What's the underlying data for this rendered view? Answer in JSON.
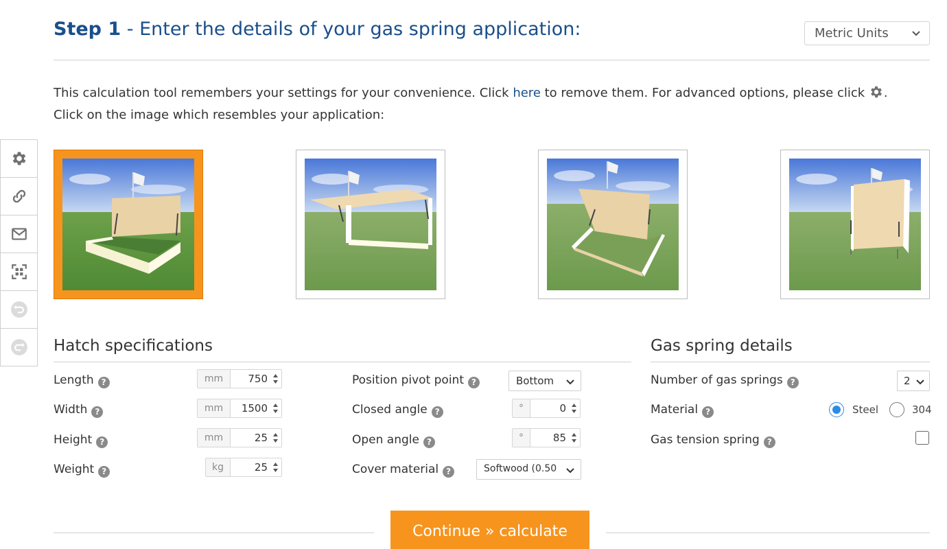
{
  "header": {
    "step_label": "Step 1",
    "title": " - Enter the details of your gas spring application:",
    "units_select": "Metric Units"
  },
  "intro": {
    "line1_a": "This calculation tool remembers your settings for your convenience. Click ",
    "link": "here",
    "line1_b": " to remove them. For advanced options, please click ",
    "line1_c": ".",
    "line2": "Click on the image which resembles your application:"
  },
  "sidebar": {
    "icons": [
      "gear-icon",
      "link-icon",
      "mail-icon",
      "qr-scan-icon",
      "undo-icon",
      "redo-icon"
    ]
  },
  "applications": {
    "selected_index": 0
  },
  "hatch": {
    "title": "Hatch specifications",
    "length": {
      "label": "Length",
      "unit": "mm",
      "value": "750"
    },
    "width": {
      "label": "Width",
      "unit": "mm",
      "value": "1500"
    },
    "height": {
      "label": "Height",
      "unit": "mm",
      "value": "25"
    },
    "weight": {
      "label": "Weight",
      "unit": "kg",
      "value": "25"
    },
    "pivot": {
      "label": "Position pivot point",
      "value": "Bottom"
    },
    "closed_angle": {
      "label": "Closed angle",
      "unit": "°",
      "value": "0"
    },
    "open_angle": {
      "label": "Open angle",
      "unit": "°",
      "value": "85"
    },
    "cover_material": {
      "label": "Cover material",
      "value": "Softwood (0.50"
    }
  },
  "gas_spring": {
    "title": "Gas spring details",
    "count": {
      "label": "Number of gas springs",
      "value": "2"
    },
    "material": {
      "label": "Material",
      "options": [
        "Steel",
        "304"
      ],
      "selected": "Steel"
    },
    "tension": {
      "label": "Gas tension spring",
      "checked": false
    }
  },
  "continue_label": "Continue » calculate",
  "help_glyph": "?",
  "colors": {
    "primary_blue": "#1a4f8b",
    "accent_orange": "#f7941d",
    "radio_blue": "#2d8be4"
  }
}
